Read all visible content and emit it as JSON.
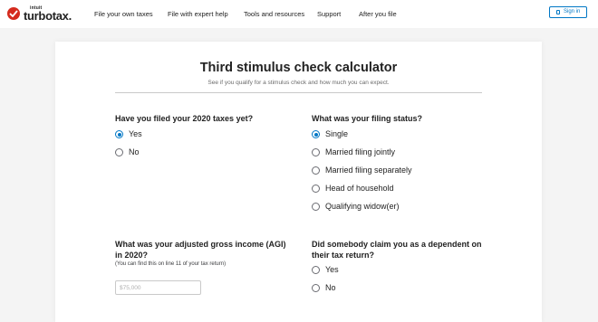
{
  "header": {
    "logo_small": "intuit",
    "logo_word": "turbotax.",
    "nav": [
      "File your own taxes",
      "File with expert help",
      "Tools and resources",
      "Support",
      "After you file"
    ],
    "signin_label": "Sign in"
  },
  "calculator": {
    "title": "Third stimulus check calculator",
    "subtitle": "See if you qualify for a stimulus check and how much you can expect.",
    "filed_2020": {
      "question": "Have you filed your 2020 taxes yet?",
      "options": [
        "Yes",
        "No"
      ],
      "selected": "Yes"
    },
    "filing_status": {
      "question": "What was your filing status?",
      "options": [
        "Single",
        "Married filing jointly",
        "Married filing separately",
        "Head of household",
        "Qualifying widow(er)"
      ],
      "selected": "Single"
    },
    "agi": {
      "question_line1": "What was your adjusted gross income (AGI)",
      "question_line2": "in 2020?",
      "note": "(You can find this on line 11 of your tax return)",
      "placeholder": "$75,000",
      "value": ""
    },
    "dependent": {
      "question_line1": "Did somebody claim you as a dependent on",
      "question_line2": "their tax return?",
      "options": [
        "Yes",
        "No"
      ],
      "selected": null
    }
  },
  "colors": {
    "brand_red": "#d52b1e",
    "accent_blue": "#0077c5",
    "page_bg": "#f4f4f4"
  }
}
